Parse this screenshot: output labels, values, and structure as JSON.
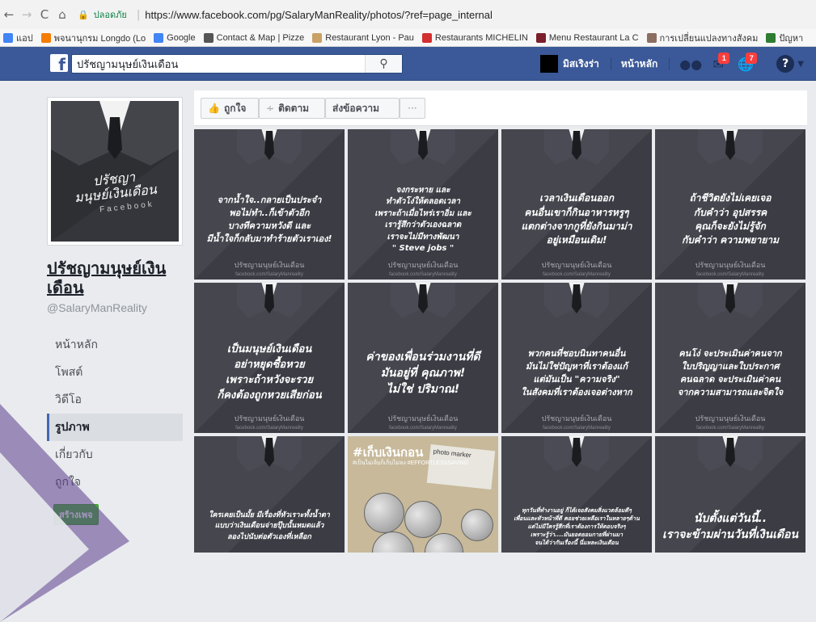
{
  "browser": {
    "secure_label": "ปลอดภัย",
    "url": "https://www.facebook.com/pg/SalaryManReality/photos/?ref=page_internal",
    "bookmarks": [
      {
        "label": "แอป",
        "color": "#4285f4"
      },
      {
        "label": "พจนานุกรม Longdo (Lo",
        "color": "#f57c00"
      },
      {
        "label": "Google",
        "color": "#4285f4"
      },
      {
        "label": "Contact & Map | Pizze",
        "color": "#555555"
      },
      {
        "label": "Restaurant Lyon - Pau",
        "color": "#c8a165"
      },
      {
        "label": "Restaurants MICHELIN",
        "color": "#d32f2f"
      },
      {
        "label": "Menu Restaurant La C",
        "color": "#7b1f2a"
      },
      {
        "label": "การเปลี่ยนแปลงทางสังคม",
        "color": "#8d6e63"
      },
      {
        "label": "ปัญหา",
        "color": "#2e7d32"
      }
    ]
  },
  "fb": {
    "search_value": "ปรัชญามนุษย์เงินเดือน",
    "user_name": "มิสเริงร่า",
    "home_label": "หน้าหลัก",
    "messages_badge": "1",
    "notifications_badge": "7"
  },
  "page": {
    "name": "ปรัชญามนุษย์เงินเดือน",
    "handle": "@SalaryManReality",
    "profile_text": "ปรัชญา\nมนุษย์เงินเดือน",
    "profile_sub": "Facebook",
    "nav": [
      {
        "label": "หน้าหลัก",
        "active": false
      },
      {
        "label": "โพสต์",
        "active": false
      },
      {
        "label": "วิดีโอ",
        "active": false
      },
      {
        "label": "รูปภาพ",
        "active": true
      },
      {
        "label": "เกี่ยวกับ",
        "active": false
      },
      {
        "label": "ถูกใจ",
        "active": false
      }
    ],
    "create_page": "สร้างเพจ"
  },
  "actions": {
    "like": "ถูกใจ",
    "follow": "ติดตาม",
    "message": "ส่งข้อความ",
    "more": "···"
  },
  "tiles": [
    {
      "text": "จากน้ำใจ..กลายเป็นประจำ\nพอไม่ทำ..ก็เข้าตัวอีก\nบางทีความหวังดี และ\nมีน้ำใจก็กลับมาทำร้ายตัวเราเอง!",
      "size": 11
    },
    {
      "text": "จงกระหาย และ\nทำตัวโง่ให้ตลอดเวลา\nเพราะถ้าเมื่อไหร่เราอิ่ม และ\nเรารู้สึกว่าตัวเองฉลาด\nเราจะไม่มีทางพัฒนา\n\" Steve jobs \"",
      "size": 10
    },
    {
      "text": "เวลาเงินเดือนออก\nคนอื่นเขาก็กินอาหารหรูๆ\nแตกต่างจากกูที่ยังกินมาม่า\nอยู่เหมือนเดิม!",
      "size": 12
    },
    {
      "text": "ถ้าชีวิตยังไม่เคยเจอ\nกับคำว่า อุปสรรค\nคุณก็จะยังไม่รู้จัก\nกับคำว่า ความพยายาม",
      "size": 12
    },
    {
      "text": "เป็นมนุษย์เงินเดือน\nอย่าหยุดซื้อหวย\nเพราะถ้าหวังจะรวย\nก็คงต้องถูกหวยเสียก่อน",
      "size": 13
    },
    {
      "text": "ค่าของเพื่อนร่วมงานที่ดี\nมันอยู่ที่ คุณภาพ!\nไม่ใช่ ปริมาณ!",
      "size": 14
    },
    {
      "text": "พวกคนที่ชอบนินทาคนอื่น\nมันไม่ใช่ปัญหาที่เราต้องแก้\nแต่มันเป็น \"ความจริง\"\nในสังคมที่เราต้องเจอต่างหาก",
      "size": 11
    },
    {
      "text": "คนโง่ จะประเมินค่าคนจาก\nใบปริญญาและใบประกาศ\nคนฉลาด จะประเมินค่าคน\nจากความสามารถและจิตใจ",
      "size": 11
    },
    {
      "text": "ใครเคยเป็นมั้ย มีเรื่องที่หัวเราะทั้งน้ำตา\nแบบว่าเงินเดือนจ่ายปุ๊บนั้นหมดแล้ว\nลองไปนับต่อตัวเองที่เหลือก",
      "size": 9
    },
    {
      "text": "#เก็บเงินกอน",
      "sub": "#เป็นไม่เจ็บก็เก็บไม่ลง #EFFORTLESSSAVING",
      "note": "photo marker"
    },
    {
      "text": "ทุกวันที่ทำงานอยู่ ก็ได้เจอสังคมสิ่งแวดล้อมดีๆ\nเพื่อนและหัวหน้าที่ดี คอยช่วยเหลือเราในหลายๆด้าน\nแต่ไม่มีใครรู้สึกที่เราต้องการให้ตอบจริงๆ\nเพราะรู้ว่า....มันยอดยอมกายที่ผ่านมา\nจนได้ว่ากันเรื่องนี้ นี่แหละเงินเดือน",
      "size": 7
    },
    {
      "text": "นับตั้งแต่วันนี้..\nเราจะข้ามผ่านวันที่เงินเดือน",
      "size": 14
    }
  ],
  "tile_brand": "ปรัชญามนุษย์เงินเดือน",
  "tile_brand_sub": "facebook.com/SalaryManreality"
}
